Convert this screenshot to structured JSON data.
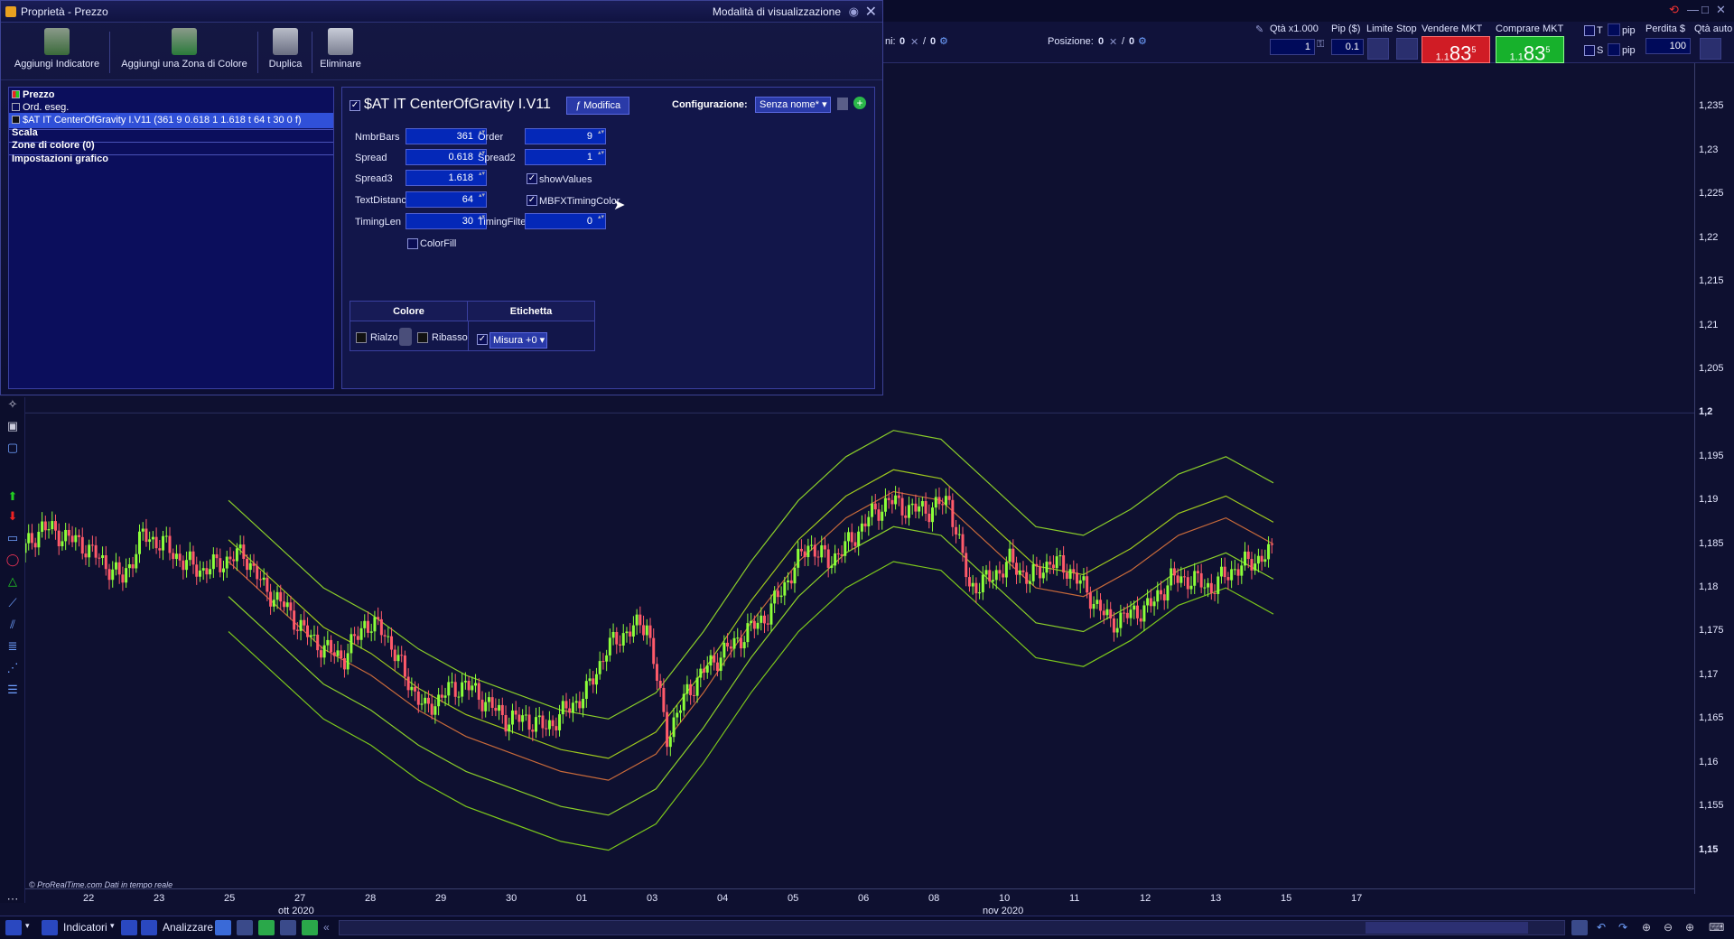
{
  "dialog": {
    "title": "Proprietà - Prezzo",
    "view_mode": "Modalità di visualizzazione",
    "toolbar": {
      "add_indicator": "Aggiungi Indicatore",
      "add_color_zone": "Aggiungi una Zona di Colore",
      "duplicate": "Duplica",
      "delete": "Eliminare"
    },
    "tree": {
      "prezzo": "Prezzo",
      "ord_eseg": "Ord. eseg.",
      "indicator": "$AT IT CenterOfGravity I.V11 (361 9 0.618 1 1.618 t 64 t 30 0 f)",
      "scala": "Scala",
      "zone": "Zone di colore (0)",
      "impostazioni": "Impostazioni grafico"
    },
    "panel": {
      "indicator_name": "$AT IT CenterOfGravity I.V11",
      "modify": "Modifica",
      "config_label": "Configurazione:",
      "config_value": "Senza nome*",
      "params": {
        "nmbrbars_label": "NmbrBars",
        "nmbrbars": "361",
        "order_label": "Order",
        "order": "9",
        "spread_label": "Spread",
        "spread": "0.618",
        "spread2_label": "Spread2",
        "spread2": "1",
        "spread3_label": "Spread3",
        "spread3": "1.618",
        "showvalues_label": "showValues",
        "textdistance_label": "TextDistance",
        "textdistance": "64",
        "mbfx_label": "MBFXTimingColor",
        "timinglen_label": "TimingLen",
        "timinglen": "30",
        "timingfilter_label": "TimingFilter",
        "timingfilter": "0",
        "colorfill_label": "ColorFill"
      },
      "table": {
        "colore": "Colore",
        "etichetta": "Etichetta",
        "rialzo": "Rialzo",
        "ribasso": "Ribasso",
        "misura": "Misura +0"
      }
    }
  },
  "trading": {
    "ni_label": "ni:",
    "ni_value": "0",
    "ni_value2": "0",
    "posizione_label": "Posizione:",
    "posizione_value": "0",
    "posizione_value2": "0",
    "qta_label": "Qtà x1.000",
    "qta_value": "1",
    "pip_label": "Pip ($)",
    "pip_value": "0.1",
    "limite": "Limite",
    "stop": "Stop",
    "vendere_label": "Vendere MKT",
    "vendere_prefix": "1.1",
    "vendere_big": "83",
    "vendere_sup": "5",
    "comprare_label": "Comprare MKT",
    "comprare_prefix": "1.1",
    "comprare_big": "83",
    "comprare_sup": "5",
    "t_label": "T",
    "t_pip": "pip",
    "s_label": "S",
    "s_pip": "pip",
    "perdita_label": "Perdita $",
    "perdita_value": "100",
    "qta_auto": "Qtà auto"
  },
  "chart_meta": {
    "copyright": "© ProRealTime.com Dati in tempo reale",
    "accent_up": "#8cff3a",
    "accent_down": "#ff5a6a"
  },
  "chart_data": {
    "type": "line",
    "ylim": [
      1.145,
      1.24
    ],
    "y_ticks": [
      "1,235",
      "1,23",
      "1,225",
      "1,22",
      "1,215",
      "1,21",
      "1,205",
      "1,2",
      "1,195",
      "1,19",
      "1,185",
      "1,18",
      "1,175",
      "1,17",
      "1,165",
      "1,16",
      "1,155",
      "1,15"
    ],
    "x_ticks": [
      "22",
      "23",
      "25",
      "27",
      "28",
      "29",
      "30",
      "01",
      "03",
      "04",
      "05",
      "06",
      "08",
      "10",
      "11",
      "12",
      "13",
      "15",
      "17"
    ],
    "x_months": [
      "ott 2020",
      "nov 2020"
    ],
    "series": [
      {
        "values": [
          1.19,
          1.185,
          1.18,
          1.177,
          1.173,
          1.17,
          1.168,
          1.166,
          1.165,
          1.168,
          1.175,
          1.183,
          1.19,
          1.195,
          1.198,
          1.197,
          1.192,
          1.187,
          1.186,
          1.189,
          1.193,
          1.195,
          1.192
        ]
      },
      {
        "values": [
          1.1855,
          1.1805,
          1.1755,
          1.1725,
          1.1685,
          1.1655,
          1.1635,
          1.1615,
          1.1605,
          1.1635,
          1.1705,
          1.1785,
          1.1855,
          1.1905,
          1.1935,
          1.1925,
          1.1875,
          1.1825,
          1.1815,
          1.1845,
          1.1885,
          1.1905,
          1.1875
        ]
      },
      {
        "values": [
          1.183,
          1.178,
          1.173,
          1.17,
          1.166,
          1.163,
          1.161,
          1.159,
          1.158,
          1.161,
          1.168,
          1.176,
          1.183,
          1.188,
          1.191,
          1.19,
          1.185,
          1.18,
          1.179,
          1.182,
          1.186,
          1.188,
          1.185
        ]
      },
      {
        "values": [
          1.179,
          1.174,
          1.169,
          1.166,
          1.162,
          1.159,
          1.157,
          1.155,
          1.154,
          1.157,
          1.164,
          1.172,
          1.179,
          1.184,
          1.187,
          1.186,
          1.181,
          1.176,
          1.175,
          1.178,
          1.182,
          1.184,
          1.181
        ]
      },
      {
        "values": [
          1.175,
          1.17,
          1.165,
          1.162,
          1.158,
          1.155,
          1.153,
          1.151,
          1.15,
          1.153,
          1.16,
          1.168,
          1.175,
          1.18,
          1.183,
          1.182,
          1.177,
          1.172,
          1.171,
          1.174,
          1.178,
          1.18,
          1.177
        ]
      }
    ],
    "price_path": [
      1.184,
      1.187,
      1.186,
      1.185,
      1.183,
      1.181,
      1.186,
      1.185,
      1.183,
      1.182,
      1.183,
      1.184,
      1.18,
      1.178,
      1.175,
      1.173,
      1.172,
      1.176,
      1.175,
      1.17,
      1.166,
      1.168,
      1.169,
      1.167,
      1.165,
      1.165,
      1.164,
      1.166,
      1.168,
      1.173,
      1.175,
      1.176,
      1.163,
      1.168,
      1.171,
      1.173,
      1.175,
      1.177,
      1.181,
      1.185,
      1.183,
      1.185,
      1.188,
      1.19,
      1.189,
      1.189,
      1.19,
      1.18,
      1.181,
      1.183,
      1.181,
      1.183,
      1.182,
      1.179,
      1.176,
      1.177,
      1.178,
      1.181,
      1.181,
      1.18,
      1.182,
      1.183,
      1.184
    ]
  },
  "bottom": {
    "indicatori": "Indicatori",
    "analizzare": "Analizzare"
  }
}
